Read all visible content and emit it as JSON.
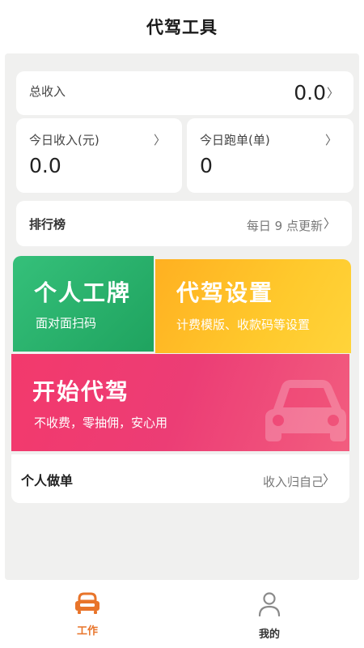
{
  "header": {
    "title": "代驾工具"
  },
  "summary": {
    "total_label": "总收入",
    "total_value": "0.0",
    "today_income_label": "今日收入(元)",
    "today_income_value": "0.0",
    "today_runs_label": "今日跑单(单)",
    "today_runs_value": "0"
  },
  "ranking": {
    "label": "排行榜",
    "note": "每日 9 点更新"
  },
  "tiles": {
    "badge": {
      "title": "个人工牌",
      "subtitle": "面对面扫码"
    },
    "settings": {
      "title": "代驾设置",
      "subtitle": "计费模版、收款码等设置"
    },
    "start": {
      "title": "开始代驾",
      "subtitle": "不收费，零抽佣，安心用"
    }
  },
  "solo": {
    "label": "个人做单",
    "note": "收入归自己"
  },
  "tabbar": {
    "work_label": "工作",
    "mine_label": "我的",
    "active_color": "#e8742a"
  },
  "colors": {
    "green": "#2bb56c",
    "orange": "#ffbf2a",
    "pink": "#f0406f",
    "background": "#f0f0ef"
  },
  "icons": {
    "work": "car-seat-icon",
    "mine": "person-icon",
    "chevron": "chevron-right-icon",
    "watermark": "car-icon"
  }
}
